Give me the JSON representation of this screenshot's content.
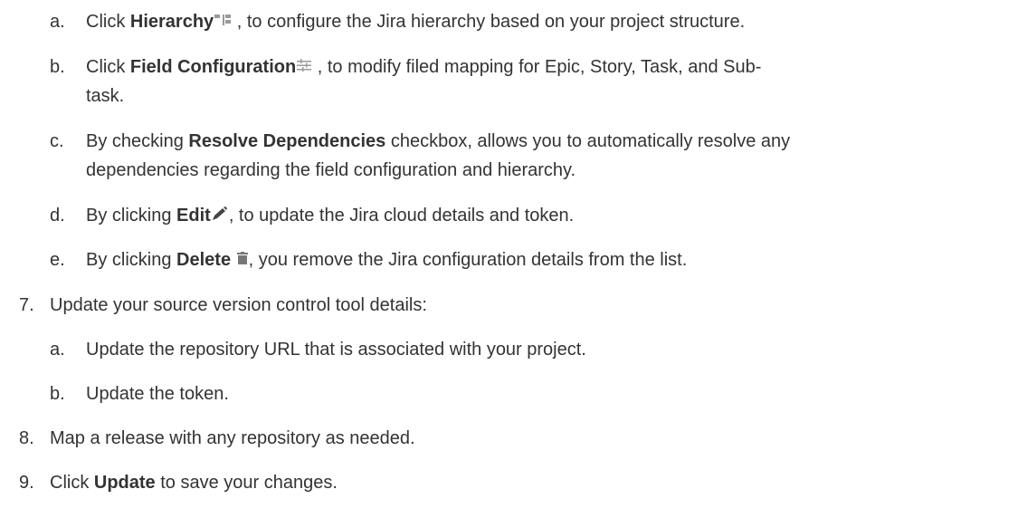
{
  "steps": [
    {
      "marker": "a.",
      "before": "Click ",
      "bold": "Hierarchy",
      "icon": "hierarchy-icon",
      "after": " , to configure the Jira hierarchy based on your project structure."
    },
    {
      "marker": "b.",
      "before": "Click ",
      "bold": "Field Configuration",
      "icon": "field-configuration-icon",
      "after": " , to modify filed mapping for Epic, Story, Task, and Sub-",
      "line2": "task."
    },
    {
      "marker": "c.",
      "before": "By checking ",
      "bold": "Resolve Dependencies",
      "after": " checkbox, allows you to automatically resolve any",
      "line2": "dependencies regarding the field configuration and hierarchy."
    },
    {
      "marker": "d.",
      "before": "By clicking ",
      "bold": "Edit",
      "icon": "pencil-icon",
      "after": ", to update the Jira cloud details and token."
    },
    {
      "marker": "e.",
      "before": "By clicking ",
      "bold": "Delete",
      "icon": "trash-icon",
      "after": ", you remove the Jira configuration details from the list."
    },
    {
      "marker": "7.",
      "text": "Update your source version control tool details:"
    },
    {
      "marker": "a.",
      "text": "Update the repository URL that is associated with your project."
    },
    {
      "marker": "b.",
      "text": "Update the token."
    },
    {
      "marker": "8.",
      "text": "Map a release with any repository as needed."
    },
    {
      "marker": "9.",
      "before": "Click ",
      "bold": "Update",
      "after": " to save your changes."
    }
  ]
}
